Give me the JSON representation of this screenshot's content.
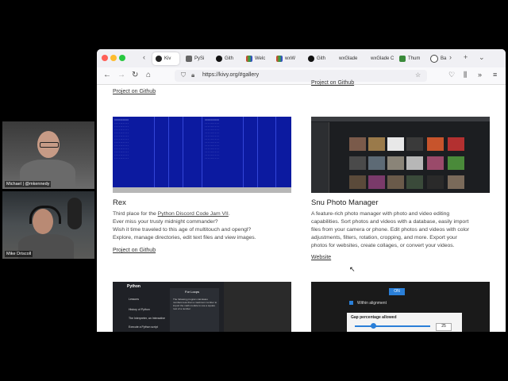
{
  "video": {
    "tiles": [
      {
        "name": "Michael | @mkennedy"
      },
      {
        "name": "Mike Driscoll"
      }
    ]
  },
  "browser": {
    "tabs": [
      {
        "label": "Kiv",
        "active": true
      },
      {
        "label": "PySi"
      },
      {
        "label": "Gith"
      },
      {
        "label": "Welc"
      },
      {
        "label": "wxW"
      },
      {
        "label": "Gith"
      },
      {
        "label": "wxGlade"
      },
      {
        "label": "wxGlade C"
      },
      {
        "label": "Thum"
      },
      {
        "label": "Ba"
      }
    ],
    "url": "https://kivy.org/#gallery"
  },
  "gallery": {
    "top_left_link": "Project on Github",
    "top_right_link": "Project on Github",
    "rex": {
      "title": "Rex",
      "desc_prefix": "Third place for the ",
      "desc_link": "Python Discord Code Jam VII",
      "desc_suffix": ".",
      "lines": [
        "Ever miss your trusty midnight commander?",
        "Wish it time traveled to this age of multitouch and opengl?",
        "Explore, manage directories, edit text files and view images."
      ],
      "link": "Project on Github"
    },
    "snu": {
      "title": "Snu Photo Manager",
      "lines": [
        "A feature-rich photo manager with photo and video editing",
        "capabilities. Sort photos and videos with a database, easily import",
        "files from your camera or phone. Edit photos and videos with color",
        "adjustments, filters, rotation, cropping, and more. Export your",
        "photos for websites, create collages, or convert your videos."
      ],
      "link": "Website"
    },
    "python_app": {
      "title": "Python",
      "items": [
        "Lessons",
        "History of Python",
        "The Interpreter, an Interactive",
        "Execute a Python script"
      ],
      "panel_title": "For Loops",
      "panel_text": "The following program calculates numbers less than a maximum number to import the math module to use a square root of a number"
    },
    "mobile_app": {
      "toggle": "ON",
      "option": "Within alignment",
      "label": "Gap percentage allowed",
      "value": "25"
    }
  },
  "colors": {
    "accent": "#0060df",
    "rex_bg": "#0c1aa0",
    "snu_bg": "#1c1e21"
  }
}
